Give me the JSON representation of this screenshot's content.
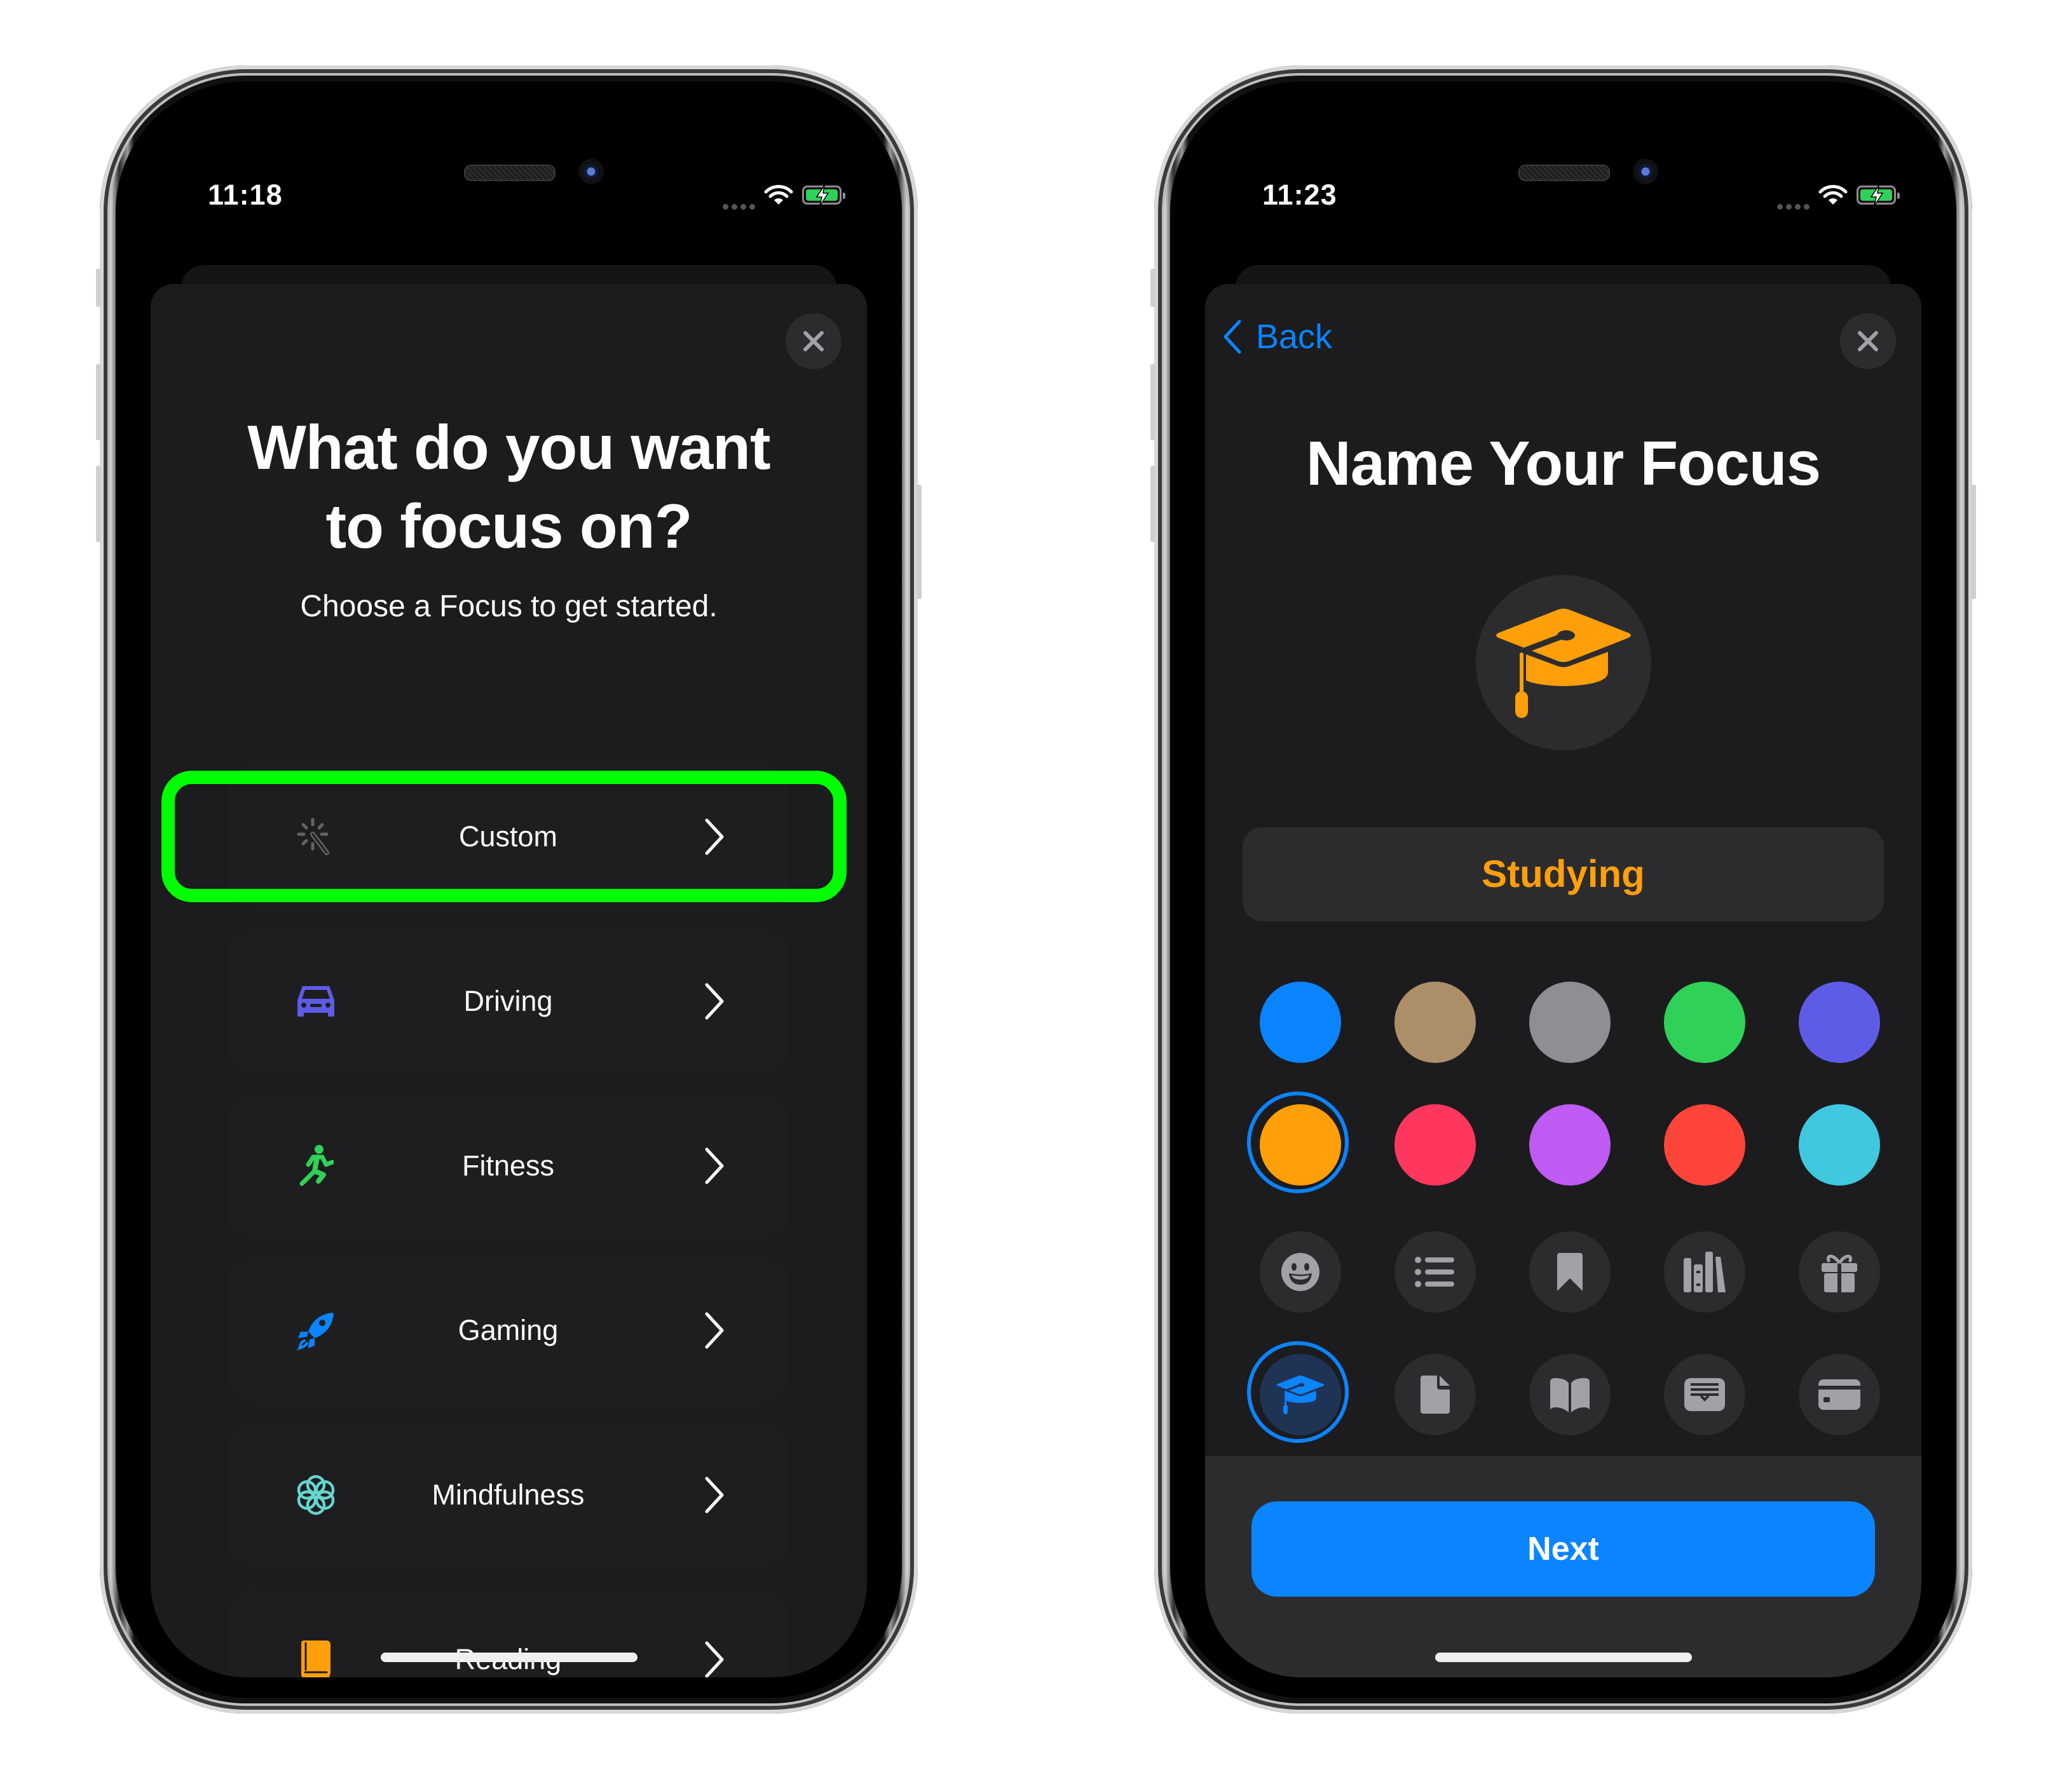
{
  "left_phone": {
    "status_bar": {
      "time": "11:18",
      "wifi_icon": "wifi-icon",
      "battery_icon": "battery-charging-icon"
    },
    "close_icon": "close-icon",
    "title": "What do you want to focus on?",
    "title_line1": "What do you want",
    "title_line2": "to focus on?",
    "subtitle": "Choose a Focus to get started.",
    "highlight_color": "#00ff00",
    "focus_options": [
      {
        "label": "Custom",
        "icon": "magic-wand-icon",
        "icon_color": "#636366",
        "highlighted": true
      },
      {
        "label": "Driving",
        "icon": "car-icon",
        "icon_color": "#5e5ce6"
      },
      {
        "label": "Fitness",
        "icon": "running-figure-icon",
        "icon_color": "#30d158"
      },
      {
        "label": "Gaming",
        "icon": "rocket-icon",
        "icon_color": "#0a84ff"
      },
      {
        "label": "Mindfulness",
        "icon": "flower-icon",
        "icon_color": "#66d4cf"
      },
      {
        "label": "Reading",
        "icon": "book-icon",
        "icon_color": "#ff9f0a"
      }
    ]
  },
  "right_phone": {
    "status_bar": {
      "time": "11:23",
      "wifi_icon": "wifi-icon",
      "battery_icon": "battery-charging-icon"
    },
    "back_label": "Back",
    "close_icon": "close-icon",
    "title": "Name Your Focus",
    "selected_icon": "graduation-cap-icon",
    "name_value": "Studying",
    "accent_color": "#ff9f0a",
    "colors": [
      {
        "name": "blue",
        "hex": "#0a84ff"
      },
      {
        "name": "brown",
        "hex": "#ac8e68"
      },
      {
        "name": "gray",
        "hex": "#8e8e93"
      },
      {
        "name": "green",
        "hex": "#30d158"
      },
      {
        "name": "indigo",
        "hex": "#5e5ce6"
      },
      {
        "name": "orange",
        "hex": "#ff9f0a",
        "selected": true
      },
      {
        "name": "pink",
        "hex": "#ff375f"
      },
      {
        "name": "purple",
        "hex": "#bf5af2"
      },
      {
        "name": "red",
        "hex": "#ff453a"
      },
      {
        "name": "teal",
        "hex": "#40c8e0"
      }
    ],
    "glyphs": [
      {
        "name": "smiley-icon"
      },
      {
        "name": "list-icon"
      },
      {
        "name": "bookmark-icon"
      },
      {
        "name": "books-icon"
      },
      {
        "name": "gift-icon"
      },
      {
        "name": "graduation-cap-icon",
        "selected": true
      },
      {
        "name": "document-icon"
      },
      {
        "name": "open-book-icon"
      },
      {
        "name": "tray-icon"
      },
      {
        "name": "credit-card-icon"
      }
    ],
    "next_label": "Next"
  }
}
